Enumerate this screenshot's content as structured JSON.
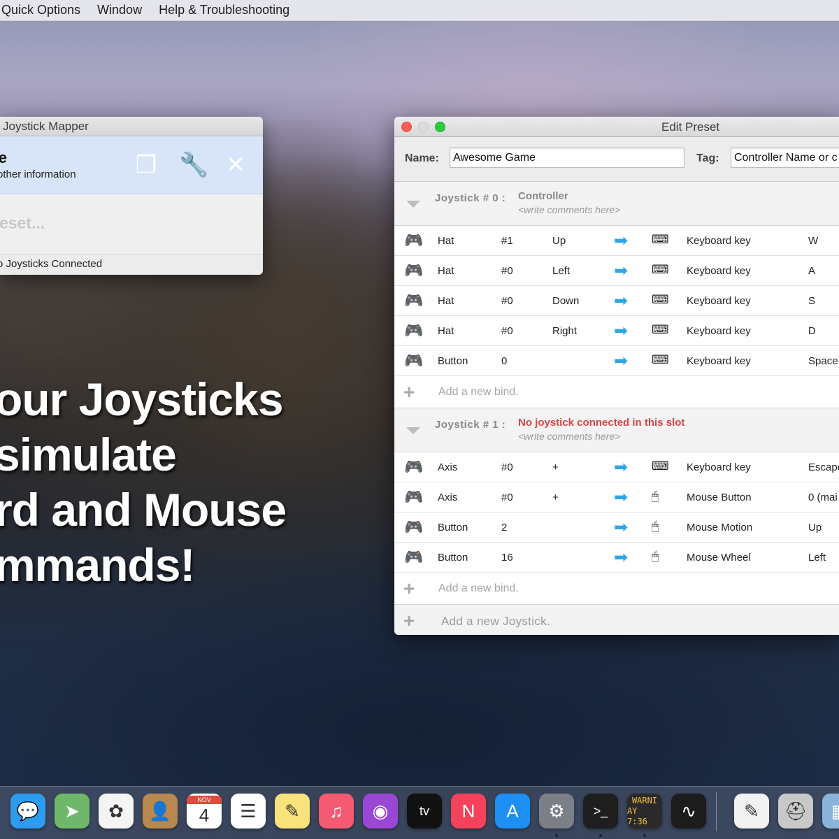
{
  "menubar": {
    "items": [
      "Quick Options",
      "Window",
      "Help & Troubleshooting"
    ]
  },
  "headline": {
    "lines": [
      "our Joysticks",
      "simulate",
      "rd and Mouse",
      "mmands!"
    ]
  },
  "mapper": {
    "title": "Joystick Mapper",
    "preset_name": "ame",
    "preset_info": "other information",
    "new_preset": "reset...",
    "status": "o Joysticks Connected",
    "icons": [
      "duplicate-icon",
      "wrench-icon",
      "close-icon"
    ]
  },
  "editor": {
    "title": "Edit Preset",
    "name_label": "Name:",
    "name_value": "Awesome Game",
    "tag_label": "Tag:",
    "tag_value": "Controller Name or c",
    "joysticks": [
      {
        "label": "Joystick # 0 :",
        "name": "Controller",
        "comment": "<write comments here>",
        "warning": false,
        "binds": [
          {
            "type": "Hat",
            "num": "#1",
            "dir": "Up",
            "device": "keyboard",
            "action": "Keyboard key",
            "value": "W"
          },
          {
            "type": "Hat",
            "num": "#0",
            "dir": "Left",
            "device": "keyboard",
            "action": "Keyboard key",
            "value": "A"
          },
          {
            "type": "Hat",
            "num": "#0",
            "dir": "Down",
            "device": "keyboard",
            "action": "Keyboard key",
            "value": "S"
          },
          {
            "type": "Hat",
            "num": "#0",
            "dir": "Right",
            "device": "keyboard",
            "action": "Keyboard key",
            "value": "D"
          },
          {
            "type": "Button",
            "num": "0",
            "dir": "",
            "device": "keyboard",
            "action": "Keyboard key",
            "value": "Space"
          }
        ],
        "add_bind": "Add a new bind."
      },
      {
        "label": "Joystick # 1 :",
        "name": "No joystick connected in this slot",
        "comment": "<write comments here>",
        "warning": true,
        "binds": [
          {
            "type": "Axis",
            "num": "#0",
            "dir": "+",
            "device": "keyboard",
            "action": "Keyboard key",
            "value": "Escape"
          },
          {
            "type": "Axis",
            "num": "#0",
            "dir": "+",
            "device": "mouse",
            "action": "Mouse Button",
            "value": "0 (mai"
          },
          {
            "type": "Button",
            "num": "2",
            "dir": "",
            "device": "mouse",
            "action": "Mouse Motion",
            "value": "Up"
          },
          {
            "type": "Button",
            "num": "16",
            "dir": "",
            "device": "mouse",
            "action": "Mouse Wheel",
            "value": "Left"
          }
        ],
        "add_bind": "Add a new bind."
      }
    ],
    "add_joystick": "Add a new Joystick."
  },
  "dock": {
    "apps": [
      {
        "name": "messages-icon",
        "glyph": "💬",
        "bg": "#2c9cf0"
      },
      {
        "name": "maps-icon",
        "glyph": "➤",
        "bg": "#6fb86a"
      },
      {
        "name": "photos-icon",
        "glyph": "✿",
        "bg": "#f4f4f4"
      },
      {
        "name": "contacts-icon",
        "glyph": "👤",
        "bg": "#b9884f"
      },
      {
        "name": "calendar-icon",
        "glyph": "4",
        "bg": "#ffffff",
        "badge": "NOV"
      },
      {
        "name": "reminders-icon",
        "glyph": "☰",
        "bg": "#ffffff"
      },
      {
        "name": "notes-icon",
        "glyph": "✎",
        "bg": "#f8e27a"
      },
      {
        "name": "music-icon",
        "glyph": "♫",
        "bg": "#f45a72"
      },
      {
        "name": "podcasts-icon",
        "glyph": "◉",
        "bg": "#9a47d6"
      },
      {
        "name": "tv-icon",
        "glyph": "tv",
        "bg": "#111111"
      },
      {
        "name": "news-icon",
        "glyph": "N",
        "bg": "#f5425a"
      },
      {
        "name": "appstore-icon",
        "glyph": "A",
        "bg": "#1d8ff5"
      },
      {
        "name": "system-preferences-icon",
        "glyph": "⚙",
        "bg": "#7b7f86"
      },
      {
        "name": "terminal-icon",
        "glyph": ">_",
        "bg": "#1e1e1e"
      },
      {
        "name": "console-icon",
        "glyph": "WARNI",
        "bg": "#2a2a2a",
        "sub": "AY 7:36"
      },
      {
        "name": "activity-monitor-icon",
        "glyph": "∿",
        "bg": "#1c1c1c"
      },
      {
        "name": "textedit-icon",
        "glyph": "✎",
        "bg": "#f2f2f2"
      },
      {
        "name": "disk-utility-icon",
        "glyph": "⛑",
        "bg": "#c8c8c8"
      },
      {
        "name": "preview-icon",
        "glyph": "▦",
        "bg": "#8ab4d9"
      }
    ]
  }
}
